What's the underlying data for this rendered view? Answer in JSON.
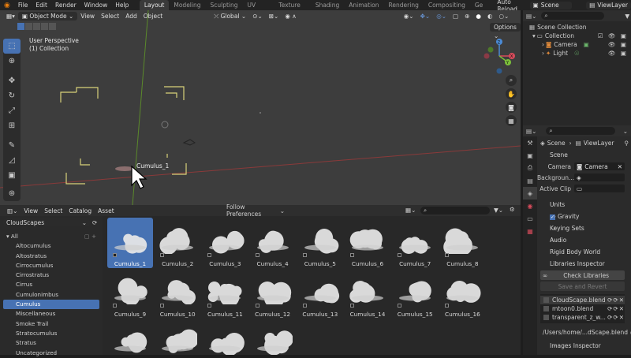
{
  "menubar": {
    "items": [
      "File",
      "Edit",
      "Render",
      "Window",
      "Help"
    ],
    "workspaces": [
      "Layout",
      "Modeling",
      "Sculpting",
      "UV Editing",
      "Texture Paint",
      "Shading",
      "Animation",
      "Rendering",
      "Compositing",
      "Ge"
    ],
    "auto_reload": "Auto Reload",
    "scene": "Scene",
    "view_layer": "ViewLayer"
  },
  "viewport": {
    "mode": "Object Mode",
    "menus": [
      "View",
      "Select",
      "Add",
      "Object"
    ],
    "transform": "Global",
    "options": "Options",
    "overlay_title": "User Perspective",
    "overlay_sub": "(1) Collection",
    "object_label": "Cumulus_1",
    "gizmo": {
      "x": "X",
      "y": "Y",
      "z": "Z"
    }
  },
  "asset_browser": {
    "menus": [
      "View",
      "Select",
      "Catalog",
      "Asset"
    ],
    "import_method": "Follow Preferences",
    "library": "CloudScapes",
    "catalogs": [
      {
        "label": "All",
        "selected": false,
        "root": true
      },
      {
        "label": "Altocumulus",
        "selected": false
      },
      {
        "label": "Altostratus",
        "selected": false
      },
      {
        "label": "Cirrocumulus",
        "selected": false
      },
      {
        "label": "Cirrostratus",
        "selected": false
      },
      {
        "label": "Cirrus",
        "selected": false
      },
      {
        "label": "Cumulonimbus",
        "selected": false
      },
      {
        "label": "Cumulus",
        "selected": true
      },
      {
        "label": "Miscellaneous",
        "selected": false
      },
      {
        "label": "Smoke Trail",
        "selected": false
      },
      {
        "label": "Stratocumulus",
        "selected": false
      },
      {
        "label": "Stratus",
        "selected": false
      },
      {
        "label": "Uncategorized",
        "selected": false
      }
    ],
    "assets": [
      {
        "label": "Cumulus_1",
        "selected": true
      },
      {
        "label": "Cumulus_2"
      },
      {
        "label": "Cumulus_3"
      },
      {
        "label": "Cumulus_4"
      },
      {
        "label": "Cumulus_5"
      },
      {
        "label": "Cumulus_6"
      },
      {
        "label": "Cumulus_7"
      },
      {
        "label": "Cumulus_8"
      },
      {
        "label": "Cumulus_9"
      },
      {
        "label": "Cumulus_10"
      },
      {
        "label": "Cumulus_11"
      },
      {
        "label": "Cumulus_12"
      },
      {
        "label": "Cumulus_13"
      },
      {
        "label": "Cumulus_14"
      },
      {
        "label": "Cumulus_15"
      },
      {
        "label": "Cumulus_16"
      },
      {
        "label": ""
      },
      {
        "label": ""
      },
      {
        "label": ""
      },
      {
        "label": ""
      }
    ]
  },
  "outliner": {
    "scene_collection": "Scene Collection",
    "collection": "Collection",
    "items": [
      "Camera",
      "Light"
    ]
  },
  "properties": {
    "breadcrumb_scene": "Scene",
    "breadcrumb_layer": "ViewLayer",
    "scene_panel": "Scene",
    "camera_label": "Camera",
    "camera_value": "Camera",
    "background_label": "Backgroun...",
    "active_clip_label": "Active Clip",
    "panels": [
      "Units",
      "Gravity",
      "Keying Sets",
      "Audio",
      "Rigid Body World",
      "Libraries Inspector"
    ],
    "check_libraries": "Check Libraries",
    "save_and_revert": "Save and Revert",
    "libraries": [
      "CloudScape.blend",
      "mtoon0.blend",
      "transparent_z_w..."
    ],
    "library_path": "/Users/home/...dScape.blend",
    "images_inspector": "Images Inspector"
  }
}
